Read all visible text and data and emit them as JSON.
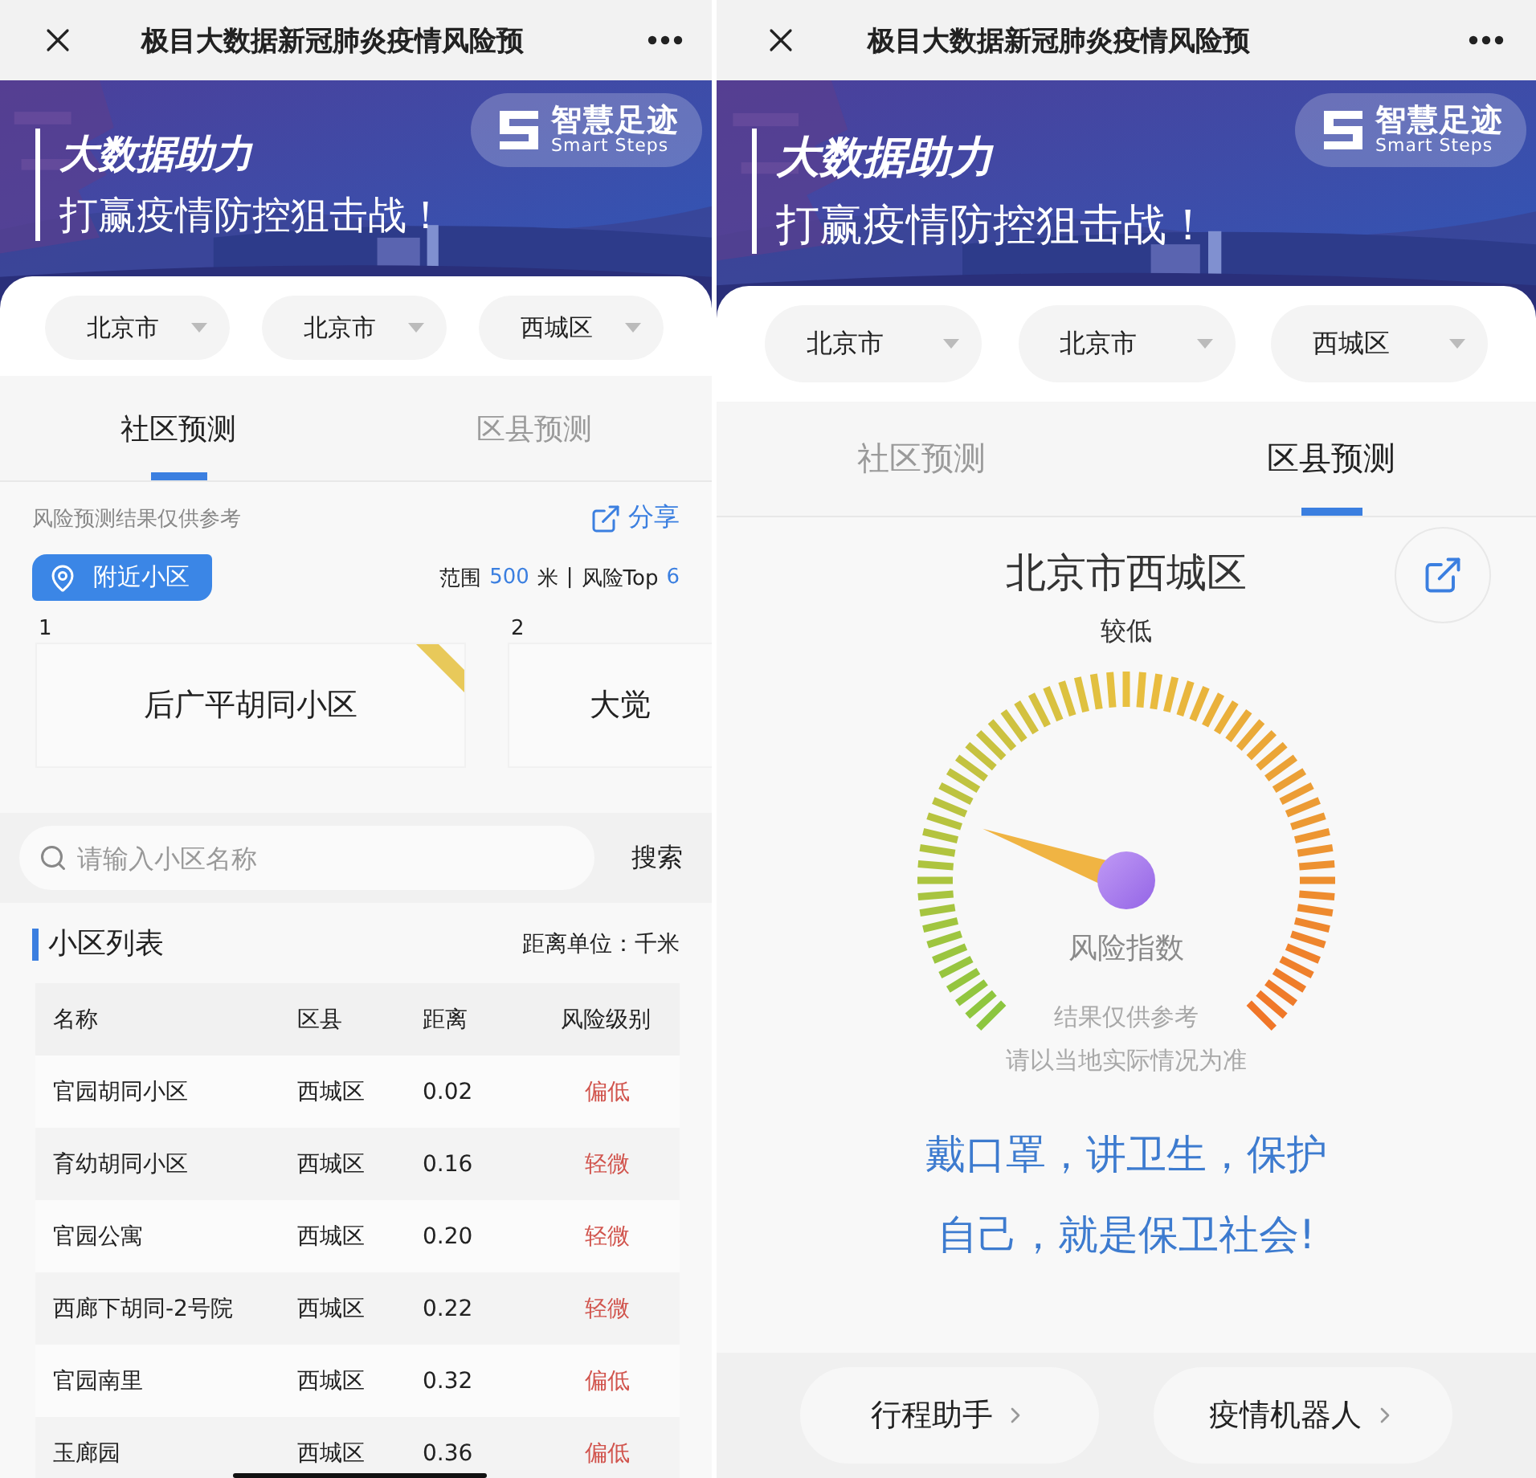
{
  "screens": [
    {
      "kind": "community",
      "title": "极目大数据新冠肺炎疫情风险预",
      "banner": {
        "headline": "大数据助力",
        "subline": "打赢疫情防控狙击战！",
        "logo_cn": "智慧足迹",
        "logo_en": "Smart Steps"
      },
      "selectors": [
        "北京市",
        "北京市",
        "西城区"
      ],
      "tabs": [
        {
          "label": "社区预测",
          "selected": true
        },
        {
          "label": "区县预测",
          "selected": false
        }
      ],
      "notice": "风险预测结果仅供参考",
      "share": "分享",
      "nearby": {
        "badge": "附近小区",
        "range_label": "范围",
        "range_value": "500",
        "range_unit": "米",
        "separator": "|",
        "top_label": "风险Top",
        "top_value": "6"
      },
      "cards": [
        {
          "rank": "1",
          "name": "后广平胡同小区",
          "ribbon": true
        },
        {
          "rank": "2",
          "name": "大觉",
          "ribbon": false
        }
      ],
      "search": {
        "placeholder": "请输入小区名称",
        "button": "搜索"
      },
      "list": {
        "title": "小区列表",
        "unit": "距离单位：千米",
        "columns": [
          "名称",
          "区县",
          "距离",
          "风险级别"
        ],
        "rows": [
          [
            "官园胡同小区",
            "西城区",
            "0.02",
            "偏低"
          ],
          [
            "育幼胡同小区",
            "西城区",
            "0.16",
            "轻微"
          ],
          [
            "官园公寓",
            "西城区",
            "0.20",
            "轻微"
          ],
          [
            "西廊下胡同-2号院",
            "西城区",
            "0.22",
            "轻微"
          ],
          [
            "官园南里",
            "西城区",
            "0.32",
            "偏低"
          ],
          [
            "玉廊园",
            "西城区",
            "0.36",
            "偏低"
          ]
        ]
      }
    },
    {
      "kind": "county",
      "title": "极目大数据新冠肺炎疫情风险预",
      "banner": {
        "headline": "大数据助力",
        "subline": "打赢疫情防控狙击战！",
        "logo_cn": "智慧足迹",
        "logo_en": "Smart Steps"
      },
      "selectors": [
        "北京市",
        "北京市",
        "西城区"
      ],
      "tabs": [
        {
          "label": "社区预测",
          "selected": false
        },
        {
          "label": "区县预测",
          "selected": true
        }
      ],
      "region": "北京市西城区",
      "risk": "较低",
      "gauge": {
        "level": 0.24,
        "label": "风险指数",
        "note_1": "结果仅供参考",
        "note_2": "请以当地实际情况为准"
      },
      "slogan_lines": [
        "戴口罩，讲卫生，保护",
        "自己，就是保卫社会!"
      ],
      "bottom_buttons": [
        "行程助手",
        "疫情机器人"
      ]
    }
  ]
}
